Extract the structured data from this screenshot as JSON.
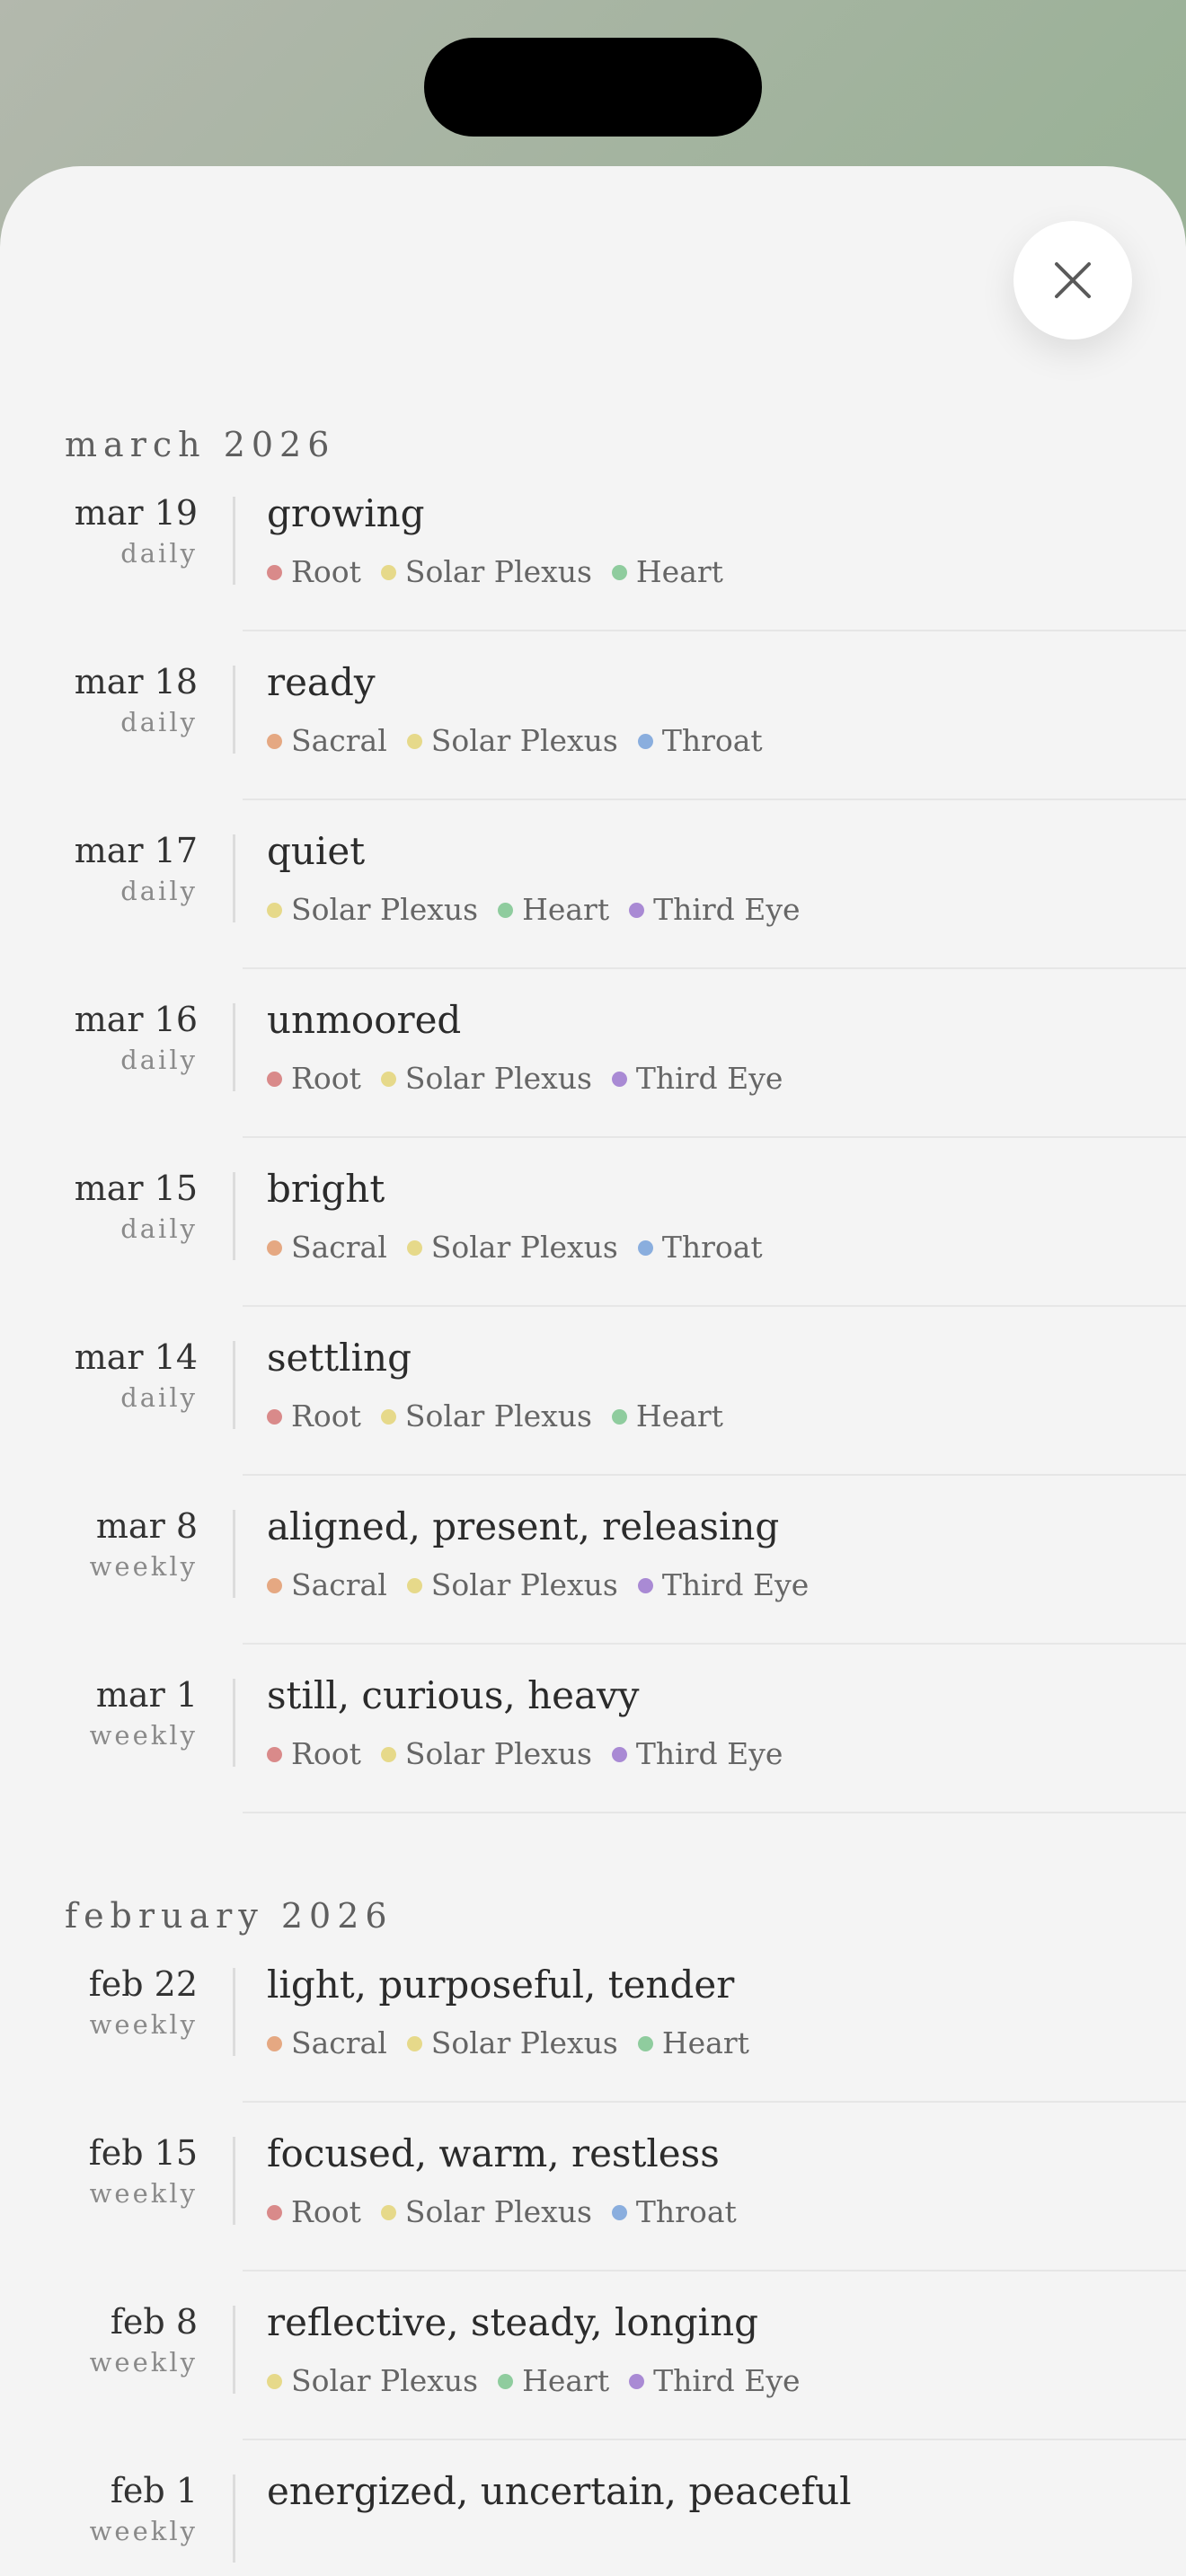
{
  "close_icon": "close-icon",
  "chakra_colors": {
    "Root": "#d98a8a",
    "Sacral": "#e5a882",
    "Solar Plexus": "#e6d98a",
    "Heart": "#8fcc9e",
    "Throat": "#8aaede",
    "Third Eye": "#a98ad4"
  },
  "months": [
    {
      "label": "march 2026",
      "entries": [
        {
          "date": "mar 19",
          "kind": "daily",
          "title": "growing",
          "tags": [
            "Root",
            "Solar Plexus",
            "Heart"
          ]
        },
        {
          "date": "mar 18",
          "kind": "daily",
          "title": "ready",
          "tags": [
            "Sacral",
            "Solar Plexus",
            "Throat"
          ]
        },
        {
          "date": "mar 17",
          "kind": "daily",
          "title": "quiet",
          "tags": [
            "Solar Plexus",
            "Heart",
            "Third Eye"
          ]
        },
        {
          "date": "mar 16",
          "kind": "daily",
          "title": "unmoored",
          "tags": [
            "Root",
            "Solar Plexus",
            "Third Eye"
          ]
        },
        {
          "date": "mar 15",
          "kind": "daily",
          "title": "bright",
          "tags": [
            "Sacral",
            "Solar Plexus",
            "Throat"
          ]
        },
        {
          "date": "mar 14",
          "kind": "daily",
          "title": "settling",
          "tags": [
            "Root",
            "Solar Plexus",
            "Heart"
          ]
        },
        {
          "date": "mar 8",
          "kind": "weekly",
          "title": "aligned, present, releasing",
          "tags": [
            "Sacral",
            "Solar Plexus",
            "Third Eye"
          ]
        },
        {
          "date": "mar 1",
          "kind": "weekly",
          "title": "still, curious, heavy",
          "tags": [
            "Root",
            "Solar Plexus",
            "Third Eye"
          ]
        }
      ]
    },
    {
      "label": "february 2026",
      "entries": [
        {
          "date": "feb 22",
          "kind": "weekly",
          "title": "light, purposeful, tender",
          "tags": [
            "Sacral",
            "Solar Plexus",
            "Heart"
          ]
        },
        {
          "date": "feb 15",
          "kind": "weekly",
          "title": "focused, warm, restless",
          "tags": [
            "Root",
            "Solar Plexus",
            "Throat"
          ]
        },
        {
          "date": "feb 8",
          "kind": "weekly",
          "title": "reflective, steady, longing",
          "tags": [
            "Solar Plexus",
            "Heart",
            "Third Eye"
          ]
        },
        {
          "date": "feb 1",
          "kind": "weekly",
          "title": "energized, uncertain, peaceful",
          "tags": []
        }
      ]
    }
  ]
}
